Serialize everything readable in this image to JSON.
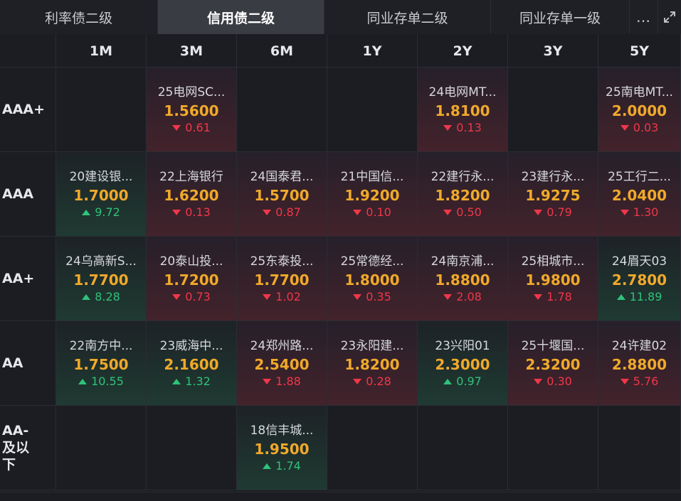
{
  "tabs": [
    {
      "label": "利率债二级",
      "active": false
    },
    {
      "label": "信用债二级",
      "active": true
    },
    {
      "label": "同业存单二级",
      "active": false
    },
    {
      "label": "同业存单一级",
      "active": false
    }
  ],
  "more_icon": "…",
  "columns": [
    "1M",
    "3M",
    "6M",
    "1Y",
    "2Y",
    "3Y",
    "5Y"
  ],
  "rows": [
    {
      "label": "AAA+",
      "cells": [
        null,
        {
          "name": "25电网SC...",
          "value": "1.5600",
          "dir": "down",
          "change": "0.61"
        },
        null,
        null,
        {
          "name": "24电网MT...",
          "value": "1.8100",
          "dir": "down",
          "change": "0.13"
        },
        null,
        {
          "name": "25南电MT...",
          "value": "2.0000",
          "dir": "down",
          "change": "0.03"
        }
      ]
    },
    {
      "label": "AAA",
      "cells": [
        {
          "name": "20建设银...",
          "value": "1.7000",
          "dir": "up",
          "change": "9.72"
        },
        {
          "name": "22上海银行",
          "value": "1.6200",
          "dir": "down",
          "change": "0.13"
        },
        {
          "name": "24国泰君...",
          "value": "1.5700",
          "dir": "down",
          "change": "0.87"
        },
        {
          "name": "21中国信...",
          "value": "1.9200",
          "dir": "down",
          "change": "0.10"
        },
        {
          "name": "22建行永...",
          "value": "1.8200",
          "dir": "down",
          "change": "0.50"
        },
        {
          "name": "23建行永...",
          "value": "1.9275",
          "dir": "down",
          "change": "0.79"
        },
        {
          "name": "25工行二...",
          "value": "2.0400",
          "dir": "down",
          "change": "1.30"
        }
      ]
    },
    {
      "label": "AA+",
      "cells": [
        {
          "name": "24乌高新S...",
          "value": "1.7700",
          "dir": "up",
          "change": "8.28"
        },
        {
          "name": "20泰山投...",
          "value": "1.7200",
          "dir": "down",
          "change": "0.73"
        },
        {
          "name": "25东泰投...",
          "value": "1.7700",
          "dir": "down",
          "change": "1.02"
        },
        {
          "name": "25常德经...",
          "value": "1.8000",
          "dir": "down",
          "change": "0.35"
        },
        {
          "name": "24南京浦...",
          "value": "1.8800",
          "dir": "down",
          "change": "2.08"
        },
        {
          "name": "25相城市...",
          "value": "1.9800",
          "dir": "down",
          "change": "1.78"
        },
        {
          "name": "24眉天03",
          "value": "2.7800",
          "dir": "up",
          "change": "11.89"
        }
      ]
    },
    {
      "label": "AA",
      "cells": [
        {
          "name": "22南方中...",
          "value": "1.7500",
          "dir": "up",
          "change": "10.55"
        },
        {
          "name": "23威海中...",
          "value": "2.1600",
          "dir": "up",
          "change": "1.32"
        },
        {
          "name": "24郑州路...",
          "value": "2.5400",
          "dir": "down",
          "change": "1.88"
        },
        {
          "name": "23永阳建...",
          "value": "1.8200",
          "dir": "down",
          "change": "0.28"
        },
        {
          "name": "23兴阳01",
          "value": "2.3000",
          "dir": "up",
          "change": "0.97"
        },
        {
          "name": "25十堰国...",
          "value": "2.3200",
          "dir": "down",
          "change": "0.30"
        },
        {
          "name": "24许建02",
          "value": "2.8800",
          "dir": "down",
          "change": "5.76"
        }
      ]
    },
    {
      "label": "AA-及以下",
      "cells": [
        null,
        null,
        {
          "name": "18信丰城...",
          "value": "1.9500",
          "dir": "up",
          "change": "1.74"
        },
        null,
        null,
        null,
        null
      ]
    }
  ],
  "colors": {
    "up": "#2fc27a",
    "down": "#f0374a",
    "value": "#f0a92a",
    "active_tab": "#3a3c43"
  }
}
